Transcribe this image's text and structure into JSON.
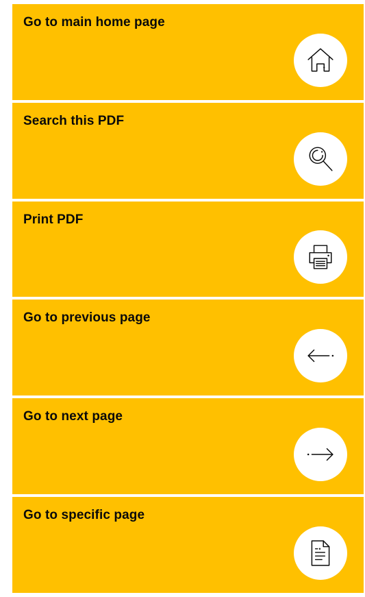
{
  "colors": {
    "accent": "#FFC000",
    "icon_bg": "#FFFFFF",
    "text": "#0A0A0A"
  },
  "nav": {
    "items": [
      {
        "label": "Go to main home page",
        "icon": "home-icon"
      },
      {
        "label": "Search this PDF",
        "icon": "search-icon"
      },
      {
        "label": "Print PDF",
        "icon": "printer-icon"
      },
      {
        "label": "Go to previous page",
        "icon": "arrow-left-icon"
      },
      {
        "label": "Go to next page",
        "icon": "arrow-right-icon"
      },
      {
        "label": "Go to specific page",
        "icon": "document-icon"
      }
    ]
  }
}
